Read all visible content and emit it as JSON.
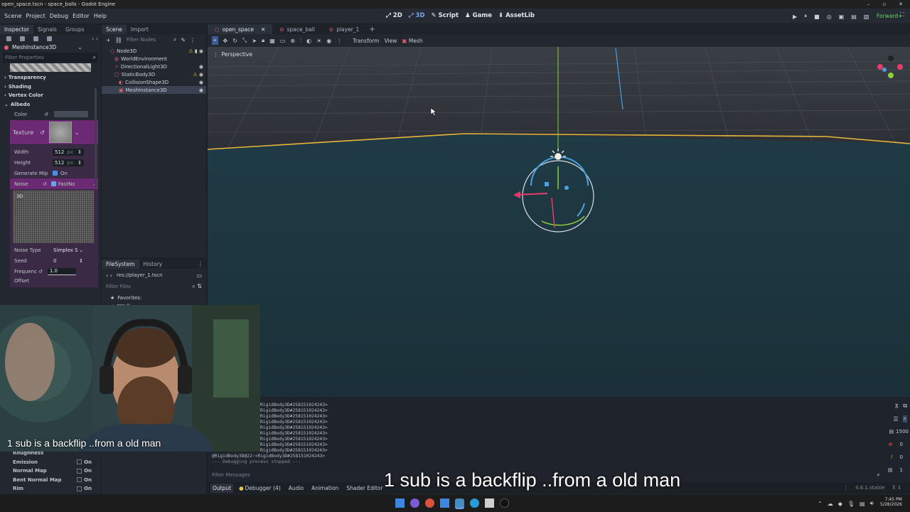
{
  "window": {
    "title": "open_space.tscn - space_balls - Godot Engine"
  },
  "menu": [
    "Scene",
    "Project",
    "Debug",
    "Editor",
    "Help"
  ],
  "workspaces": [
    {
      "icon": "2d-icon",
      "label": "2D"
    },
    {
      "icon": "3d-icon",
      "label": "3D"
    },
    {
      "icon": "script-icon",
      "label": "Script"
    },
    {
      "icon": "game-icon",
      "label": "Game"
    },
    {
      "icon": "assetlib-icon",
      "label": "AssetLib"
    }
  ],
  "renderer": "Forward+",
  "inspector": {
    "tabs": [
      "Inspector",
      "Signals",
      "Groups"
    ],
    "node_selector": "MeshInstance3D",
    "filter_placeholder": "Filter Properties",
    "sections": [
      "Transparency",
      "Shading",
      "Vertex Color",
      "Albedo"
    ],
    "albedo": {
      "color_label": "Color",
      "texture_label": "Texture",
      "width_label": "Width",
      "width_value": "512",
      "width_unit": "px",
      "height_label": "Height",
      "height_value": "512",
      "height_unit": "px",
      "generate_mip_label": "Generate Mip",
      "generate_mip_value": "On",
      "noise_label": "Noise",
      "noise_value": "FastNo",
      "preview_label": "3D",
      "noise_type_label": "Noise Type",
      "noise_type_value": "Simplex S",
      "seed_label": "Seed",
      "seed_value": "0",
      "frequency_label": "Frequenc",
      "frequency_value": "1.0",
      "offset_label": "Offset"
    },
    "lower_rows": [
      {
        "label": "Roughness",
        "value": ""
      },
      {
        "label": "Emission",
        "value": "On"
      },
      {
        "label": "Normal Map",
        "value": "On"
      },
      {
        "label": "Bent Normal Map",
        "value": "On"
      },
      {
        "label": "Rim",
        "value": "On"
      }
    ]
  },
  "scene_dock": {
    "tabs": [
      "Scene",
      "Import"
    ],
    "filter_placeholder": "Filter Nodes",
    "tree": [
      {
        "label": "Node3D",
        "depth": 0,
        "color": "#e06070",
        "selected": false,
        "warn": true
      },
      {
        "label": "WorldEnvironment",
        "depth": 1,
        "color": "#e06070",
        "selected": false,
        "warn": false
      },
      {
        "label": "DirectionalLight3D",
        "depth": 1,
        "color": "#e06070",
        "selected": false,
        "warn": false
      },
      {
        "label": "StaticBody3D",
        "depth": 1,
        "color": "#e06070",
        "selected": false,
        "warn": true
      },
      {
        "label": "CollisionShape3D",
        "depth": 2,
        "color": "#e06070",
        "selected": false,
        "warn": false
      },
      {
        "label": "MeshInstance3D",
        "depth": 2,
        "color": "#e06070",
        "selected": true,
        "warn": false
      }
    ]
  },
  "filesystem": {
    "tabs": [
      "FileSystem",
      "History"
    ],
    "path": "res://player_1.tscn",
    "filter_placeholder": "Filter Files",
    "favorites_label": "Favorites:",
    "res_label": "res://"
  },
  "scene_tabs": [
    {
      "label": "open_space",
      "active": true
    },
    {
      "label": "space_ball",
      "active": false
    },
    {
      "label": "player_1",
      "active": false
    }
  ],
  "viewport": {
    "toolbar_menus": [
      "Transform",
      "View"
    ],
    "mesh_menu": "Mesh",
    "perspective_label": "Perspective"
  },
  "output": {
    "lines": [
      "RigidBody3D#258151024243>",
      "RigidBody3D#258151024243>",
      "RigidBody3D#258151024243>",
      "RigidBody3D#258151024243>",
      "RigidBody3D#258151024243>",
      "RigidBody3D#258151024243>",
      "RigidBody3D#258151024243>",
      "RigidBody3D#258151024243>",
      "RigidBody3D#258151024243>",
      "@RigidBody3D@22:<RigidBody3D#258151024243>",
      "--- Debugging process stopped ---"
    ],
    "filter_placeholder": "Filter Messages",
    "counts": {
      "messages": "1500",
      "errors": "0",
      "warnings": "0",
      "info": "1"
    }
  },
  "bottom_tabs": [
    "Output",
    "Debugger (4)",
    "Audio",
    "Animation",
    "Shader Editor"
  ],
  "version": "4.6.1.stable",
  "caption": "1 sub is a backflip ..from a old man",
  "clock": {
    "time": "7:45 PM",
    "date": "5/28/2026"
  },
  "colors": {
    "accent": "#76a6f0",
    "selection": "#3b4352",
    "horizon": "#e8b53a",
    "floor": "#1e3a44"
  }
}
